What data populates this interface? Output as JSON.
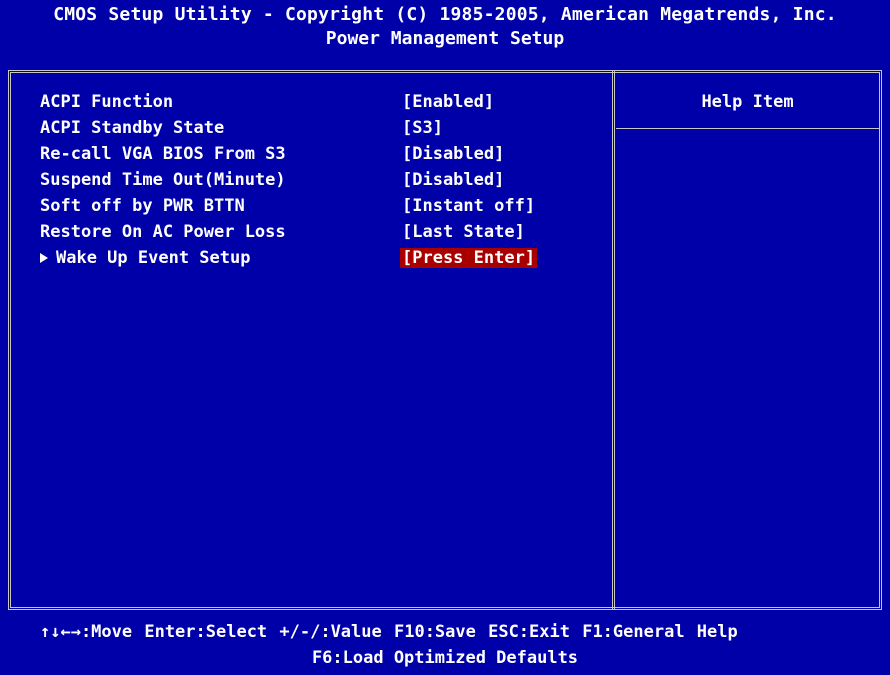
{
  "header": {
    "title": "CMOS Setup Utility - Copyright (C) 1985-2005, American Megatrends, Inc.",
    "subtitle": "Power Management Setup"
  },
  "help": {
    "title": "Help Item"
  },
  "items": [
    {
      "label": "ACPI Function",
      "value": "[Enabled]"
    },
    {
      "label": "ACPI Standby State",
      "value": "[S3]"
    },
    {
      "label": "Re-call VGA BIOS From S3",
      "value": "[Disabled]"
    },
    {
      "label": "Suspend Time Out(Minute)",
      "value": "[Disabled]"
    },
    {
      "label": "Soft off by PWR BTTN",
      "value": "[Instant off]"
    },
    {
      "label": "Restore On AC Power Loss",
      "value": "[Last State]"
    },
    {
      "label": "Wake Up Event Setup",
      "value": "[Press Enter]",
      "submenu": true,
      "selected": true
    }
  ],
  "footer": {
    "line1": "↑↓←→:Move  Enter:Select  +/-/:Value  F10:Save  ESC:Exit  F1:General Help",
    "line2": "F6:Load Optimized Defaults"
  },
  "colors": {
    "background": "#0000a8",
    "selection": "#a80000",
    "text": "#ffffff",
    "frame": "#c8c8c8"
  }
}
